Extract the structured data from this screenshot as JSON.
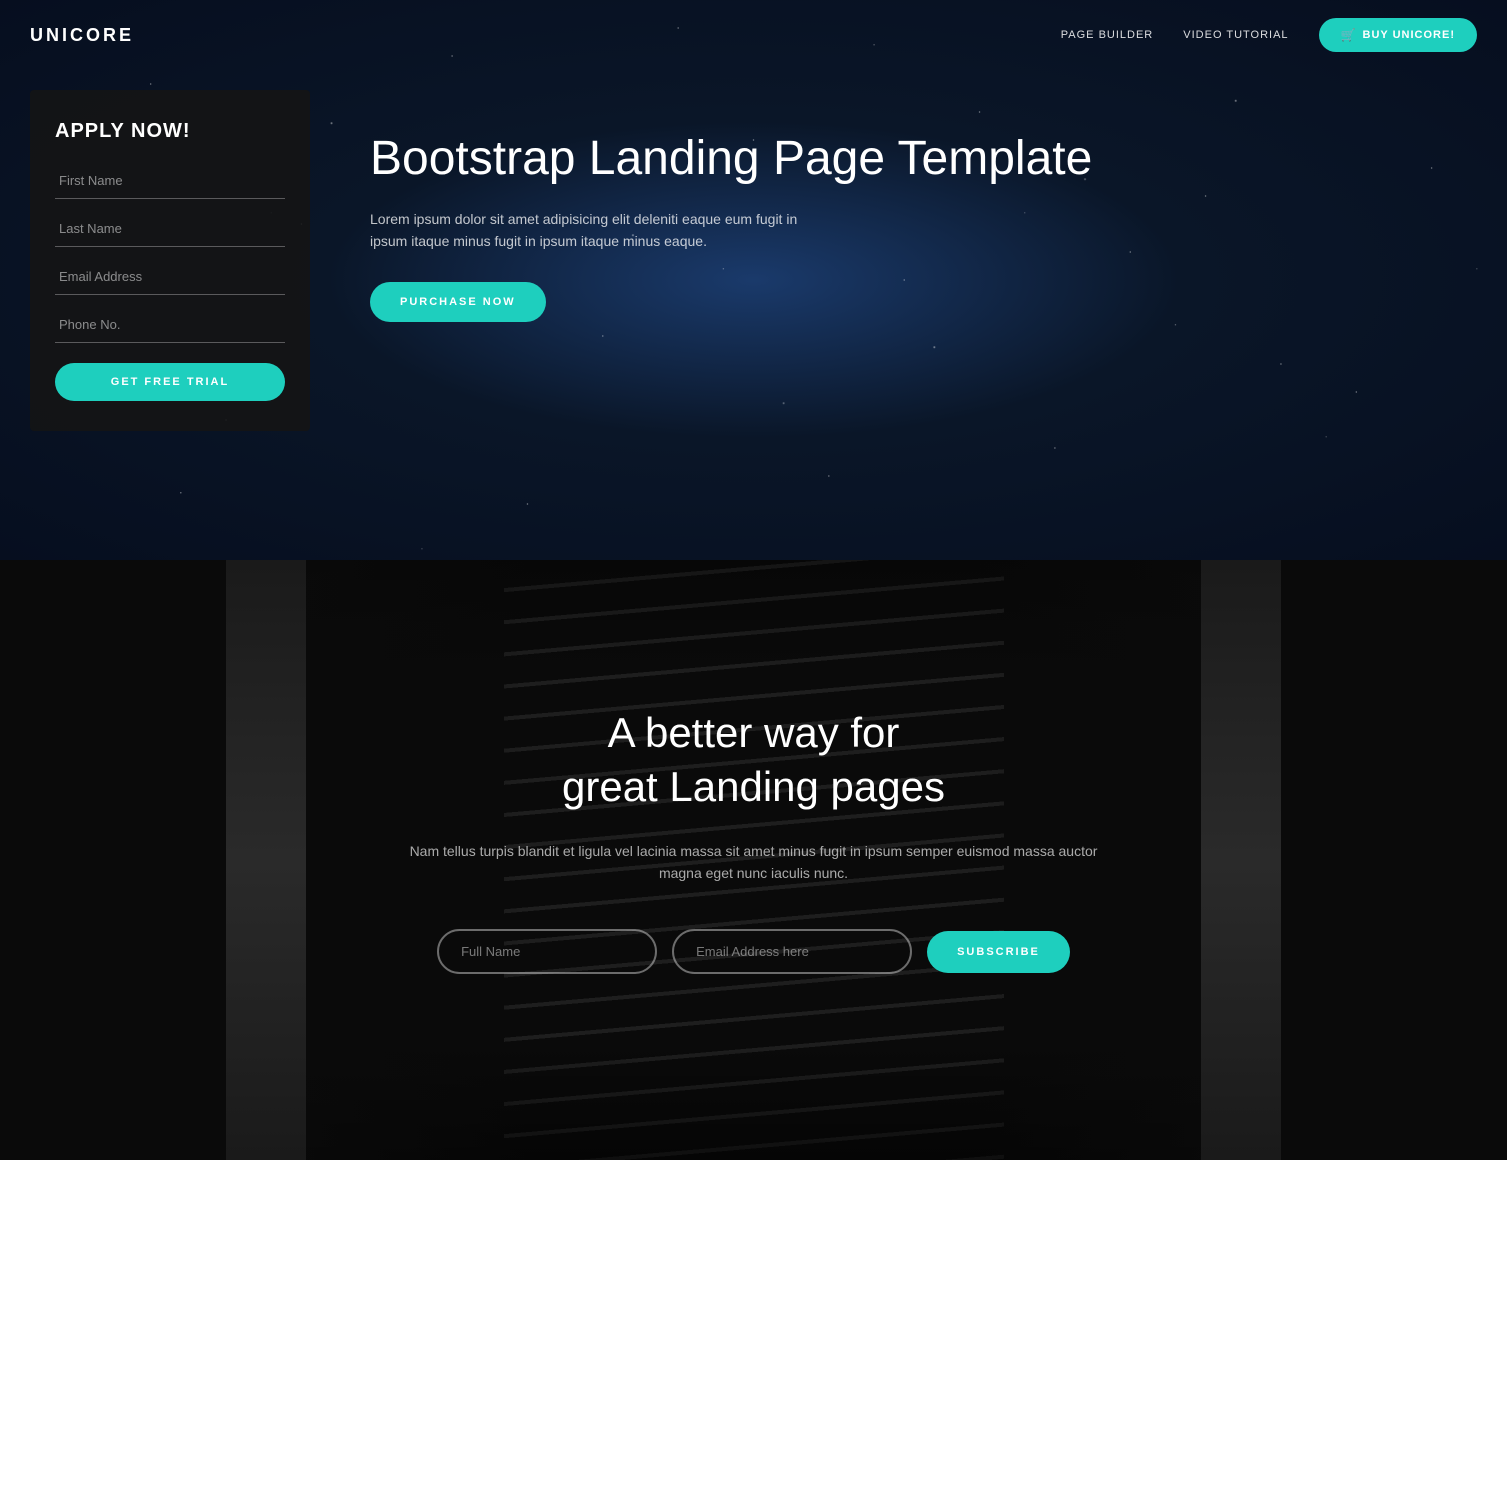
{
  "brand": {
    "name": "UNICORE"
  },
  "navbar": {
    "links": [
      {
        "label": "PAGE BUILDER"
      },
      {
        "label": "VIDEO TUTORIAL"
      }
    ],
    "buy_button": "BUY UNICORE!"
  },
  "hero": {
    "apply_form": {
      "title": "APPLY NOW!",
      "first_name_placeholder": "First Name",
      "last_name_placeholder": "Last Name",
      "email_placeholder": "Email Address",
      "phone_placeholder": "Phone No.",
      "submit_label": "GET FREE TRIAL"
    },
    "headline": "Bootstrap Landing Page Template",
    "description": "Lorem ipsum dolor sit amet adipisicing elit deleniti eaque eum fugit in ipsum itaque minus fugit in ipsum itaque minus eaque.",
    "purchase_label": "PURCHASE NOW"
  },
  "escalator_section": {
    "title_line1": "A better way for",
    "title_line2": "great Landing pages",
    "description": "Nam tellus turpis blandit et ligula vel lacinia massa sit amet minus fugit in ipsum semper euismod massa auctor magna eget nunc iaculis nunc.",
    "full_name_placeholder": "Full Name",
    "email_placeholder": "Email Address here",
    "subscribe_label": "SUBSCRIBE"
  },
  "colors": {
    "accent": "#1ecfbe",
    "dark_bg": "#0d1b3e",
    "escalator_bg": "#0a0a0a"
  }
}
